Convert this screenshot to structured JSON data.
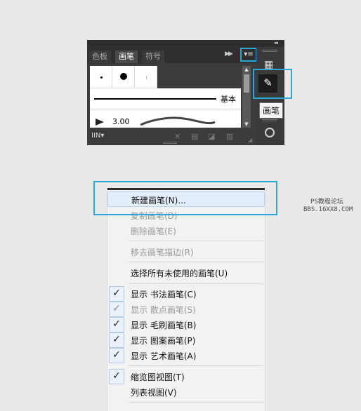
{
  "panel": {
    "tabs": [
      "色板",
      "画笔",
      "符号"
    ],
    "active_tab": "画笔",
    "tab_more_icon": "double-chevron-right",
    "menu_icon": "panel-menu",
    "brush_default_name": "基本",
    "brush_size_value": "3.00",
    "libs_label": "IIN▾"
  },
  "dock": {
    "collapse_glyph": "◂◂",
    "tooltip": "画笔"
  },
  "menu": {
    "items": [
      {
        "label": "新建画笔(N)...",
        "hover": true
      },
      {
        "label": "复制画笔(D)",
        "disabled": true
      },
      {
        "label": "删除画笔(E)",
        "disabled": true
      },
      {
        "label": "移去画笔描边(R)",
        "disabled": true
      },
      {
        "label": "选择所有未使用的画笔(U)"
      },
      {
        "label": "显示 书法画笔(C)",
        "checked": true
      },
      {
        "label": "显示 散点画笔(S)",
        "checked": true,
        "dim": true
      },
      {
        "label": "显示 毛刷画笔(B)",
        "checked": true
      },
      {
        "label": "显示 图案画笔(P)",
        "checked": true
      },
      {
        "label": "显示 艺术画笔(A)",
        "checked": true
      },
      {
        "label": "缩览图视图(T)",
        "checked": true
      },
      {
        "label": "列表视图(V)"
      }
    ]
  },
  "watermark": {
    "line1": "PS教程论坛",
    "line2": "BBS.16XX8.COM"
  },
  "colors": {
    "highlight": "#2aa9d8",
    "panel_bg": "#3c3c3c"
  }
}
